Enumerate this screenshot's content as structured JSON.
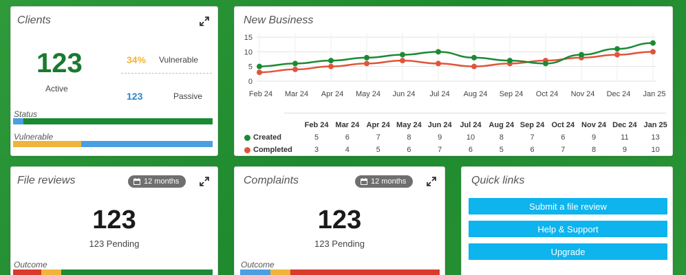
{
  "clients": {
    "title": "Clients",
    "active_count": "123",
    "active_label": "Active",
    "vulnerable_pct": "34%",
    "vulnerable_label": "Vulnerable",
    "passive_count": "123",
    "passive_label": "Passive",
    "status_label": "Status",
    "status_bar": [
      {
        "color": "#4a9fe0",
        "fraction": 0.05
      },
      {
        "color": "#1b8a34",
        "fraction": 0.95
      }
    ],
    "vulnerable_bar_label": "Vulnerable",
    "vulnerable_bar": [
      {
        "color": "#f0b43c",
        "fraction": 0.34
      },
      {
        "color": "#4a9fe0",
        "fraction": 0.66
      }
    ]
  },
  "new_business": {
    "title": "New Business",
    "colors": {
      "created": "#1b8a34",
      "completed": "#e0553a"
    },
    "table_rows": [
      {
        "label": "Created",
        "color": "#1b8a34",
        "values": [
          "5",
          "6",
          "7",
          "8",
          "9",
          "10",
          "8",
          "7",
          "6",
          "9",
          "11",
          "13"
        ]
      },
      {
        "label": "Completed",
        "color": "#e0553a",
        "values": [
          "3",
          "4",
          "5",
          "6",
          "7",
          "6",
          "5",
          "6",
          "7",
          "8",
          "9",
          "10"
        ]
      }
    ]
  },
  "chart_data": {
    "type": "line",
    "title": "New Business",
    "categories": [
      "Feb 24",
      "Mar 24",
      "Apr 24",
      "May 24",
      "Jun 24",
      "Jul 24",
      "Aug 24",
      "Sep 24",
      "Oct 24",
      "Nov 24",
      "Dec 24",
      "Jan 25"
    ],
    "series": [
      {
        "name": "Created",
        "color": "#1b8a34",
        "values": [
          5,
          6,
          7,
          8,
          9,
          10,
          8,
          7,
          6,
          9,
          11,
          13
        ]
      },
      {
        "name": "Completed",
        "color": "#e0553a",
        "values": [
          3,
          4,
          5,
          6,
          7,
          6,
          5,
          6,
          7,
          8,
          9,
          10
        ]
      }
    ],
    "yticks": [
      "15",
      "10",
      "5",
      "0"
    ],
    "ylim": [
      0,
      15
    ],
    "grid": true,
    "legend": "table-below"
  },
  "file_reviews": {
    "title": "File reviews",
    "period": "12 months",
    "count": "123",
    "pending": "123 Pending",
    "outcome_label": "Outcome",
    "outcome_bar": [
      {
        "color": "#d93a2b",
        "fraction": 0.14
      },
      {
        "color": "#f0b43c",
        "fraction": 0.1
      },
      {
        "color": "#1b8a34",
        "fraction": 0.76
      }
    ]
  },
  "complaints": {
    "title": "Complaints",
    "period": "12 months",
    "count": "123",
    "pending": "123 Pending",
    "outcome_label": "Outcome",
    "outcome_bar": [
      {
        "color": "#4a9fe0",
        "fraction": 0.15
      },
      {
        "color": "#f0b43c",
        "fraction": 0.1
      },
      {
        "color": "#d93a2b",
        "fraction": 0.75
      }
    ]
  },
  "quick_links": {
    "title": "Quick links",
    "links": [
      "Submit a file review",
      "Help & Support",
      "Upgrade"
    ]
  }
}
